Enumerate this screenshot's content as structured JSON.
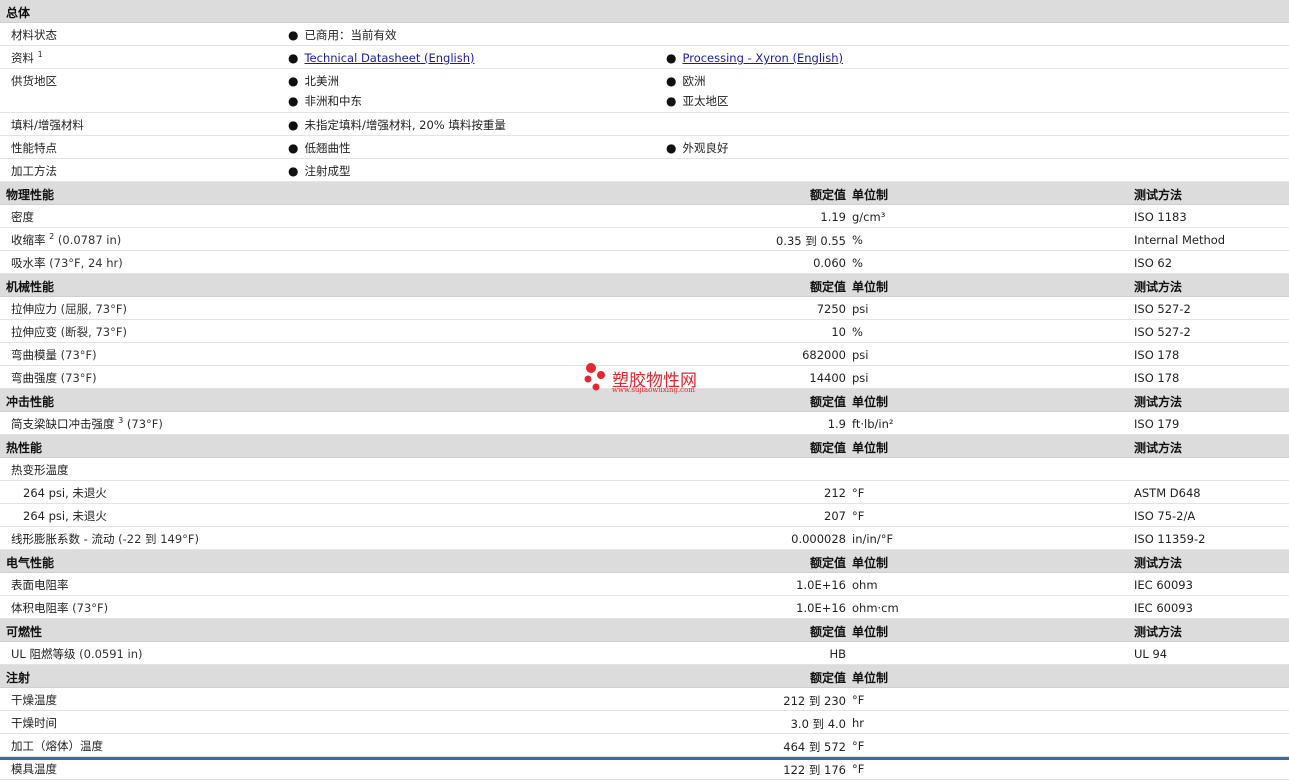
{
  "general": {
    "title": "总体",
    "status_label": "材料状态",
    "status_value": "已商用：当前有效",
    "docs_label": "资料",
    "docs_sup": "1",
    "doc1": "Technical Datasheet (English)",
    "doc2": "Processing - Xyron (English)",
    "region_label": "供货地区",
    "regions": [
      "北美洲",
      "欧洲",
      "非洲和中东",
      "亚太地区"
    ],
    "filler_label": "填料/增强材料",
    "filler_value": "未指定填料/增强材料, 20% 填料按重量",
    "features_label": "性能特点",
    "features": [
      "低翘曲性",
      "外观良好"
    ],
    "process_label": "加工方法",
    "process_value": "注射成型"
  },
  "headers": {
    "nominal": "额定值",
    "unit": "单位制",
    "method": "测试方法"
  },
  "physical": {
    "title": "物理性能",
    "rows": [
      {
        "label": "密度",
        "cond": "",
        "sup": "",
        "value": "1.19",
        "unit": "g/cm³",
        "method": "ISO 1183"
      },
      {
        "label": "收缩率",
        "sup": "2",
        "cond": " (0.0787 in)",
        "value": "0.35 到  0.55",
        "unit": "%",
        "method": "Internal Method"
      },
      {
        "label": "吸水率",
        "cond": " (73°F, 24 hr)",
        "sup": "",
        "value": "0.060",
        "unit": "%",
        "method": "ISO 62"
      }
    ]
  },
  "mechanical": {
    "title": "机械性能",
    "rows": [
      {
        "label": "拉伸应力",
        "cond": " (屈服, 73°F)",
        "value": "7250",
        "unit": "psi",
        "method": "ISO 527-2"
      },
      {
        "label": "拉伸应变",
        "cond": " (断裂, 73°F)",
        "value": "10",
        "unit": "%",
        "method": "ISO 527-2"
      },
      {
        "label": "弯曲模量",
        "cond": " (73°F)",
        "value": "682000",
        "unit": "psi",
        "method": "ISO 178"
      },
      {
        "label": "弯曲强度",
        "cond": " (73°F)",
        "value": "14400",
        "unit": "psi",
        "method": "ISO 178"
      }
    ]
  },
  "impact": {
    "title": "冲击性能",
    "rows": [
      {
        "label": "简支梁缺口冲击强度",
        "sup": "3",
        "cond": " (73°F)",
        "value": "1.9",
        "unit": "ft·lb/in²",
        "method": "ISO 179"
      }
    ]
  },
  "thermal": {
    "title": "热性能",
    "hdt_label": "热变形温度",
    "rows": [
      {
        "label": "264 psi, 未退火",
        "value": "212",
        "unit": "°F",
        "method": "ASTM D648"
      },
      {
        "label": "264 psi, 未退火",
        "value": "207",
        "unit": "°F",
        "method": "ISO 75-2/A"
      }
    ],
    "clte": {
      "label": "线形膨胀系数  - 流动",
      "cond": " (-22 到  149°F)",
      "value": "0.000028",
      "unit": "in/in/°F",
      "method": "ISO 11359-2"
    }
  },
  "electrical": {
    "title": "电气性能",
    "rows": [
      {
        "label": "表面电阻率",
        "cond": "",
        "value": "1.0E+16",
        "unit": "ohm",
        "method": "IEC 60093"
      },
      {
        "label": "体积电阻率",
        "cond": " (73°F)",
        "value": "1.0E+16",
        "unit": "ohm·cm",
        "method": "IEC 60093"
      }
    ]
  },
  "flammability": {
    "title": "可燃性",
    "rows": [
      {
        "label": "UL 阻燃等级",
        "cond": " (0.0591 in)",
        "value": "HB",
        "unit": "",
        "method": "UL 94"
      }
    ]
  },
  "injection": {
    "title": "注射",
    "rows": [
      {
        "label": "干燥温度",
        "value": "212 到  230",
        "unit": "°F"
      },
      {
        "label": "干燥时间",
        "value": "3.0 到  4.0",
        "unit": "hr"
      },
      {
        "label": "加工（熔体）温度",
        "value": "464 到  572",
        "unit": "°F"
      },
      {
        "label": "模具温度",
        "value": "122 到  176",
        "unit": "°F"
      }
    ]
  },
  "watermark": {
    "title": "塑胶物性网",
    "url": "www.sujiaowuxing.com"
  },
  "colors": {
    "section_bg": "#dcdcdc",
    "link": "#1a1aa6",
    "watermark": "#e8262d"
  }
}
